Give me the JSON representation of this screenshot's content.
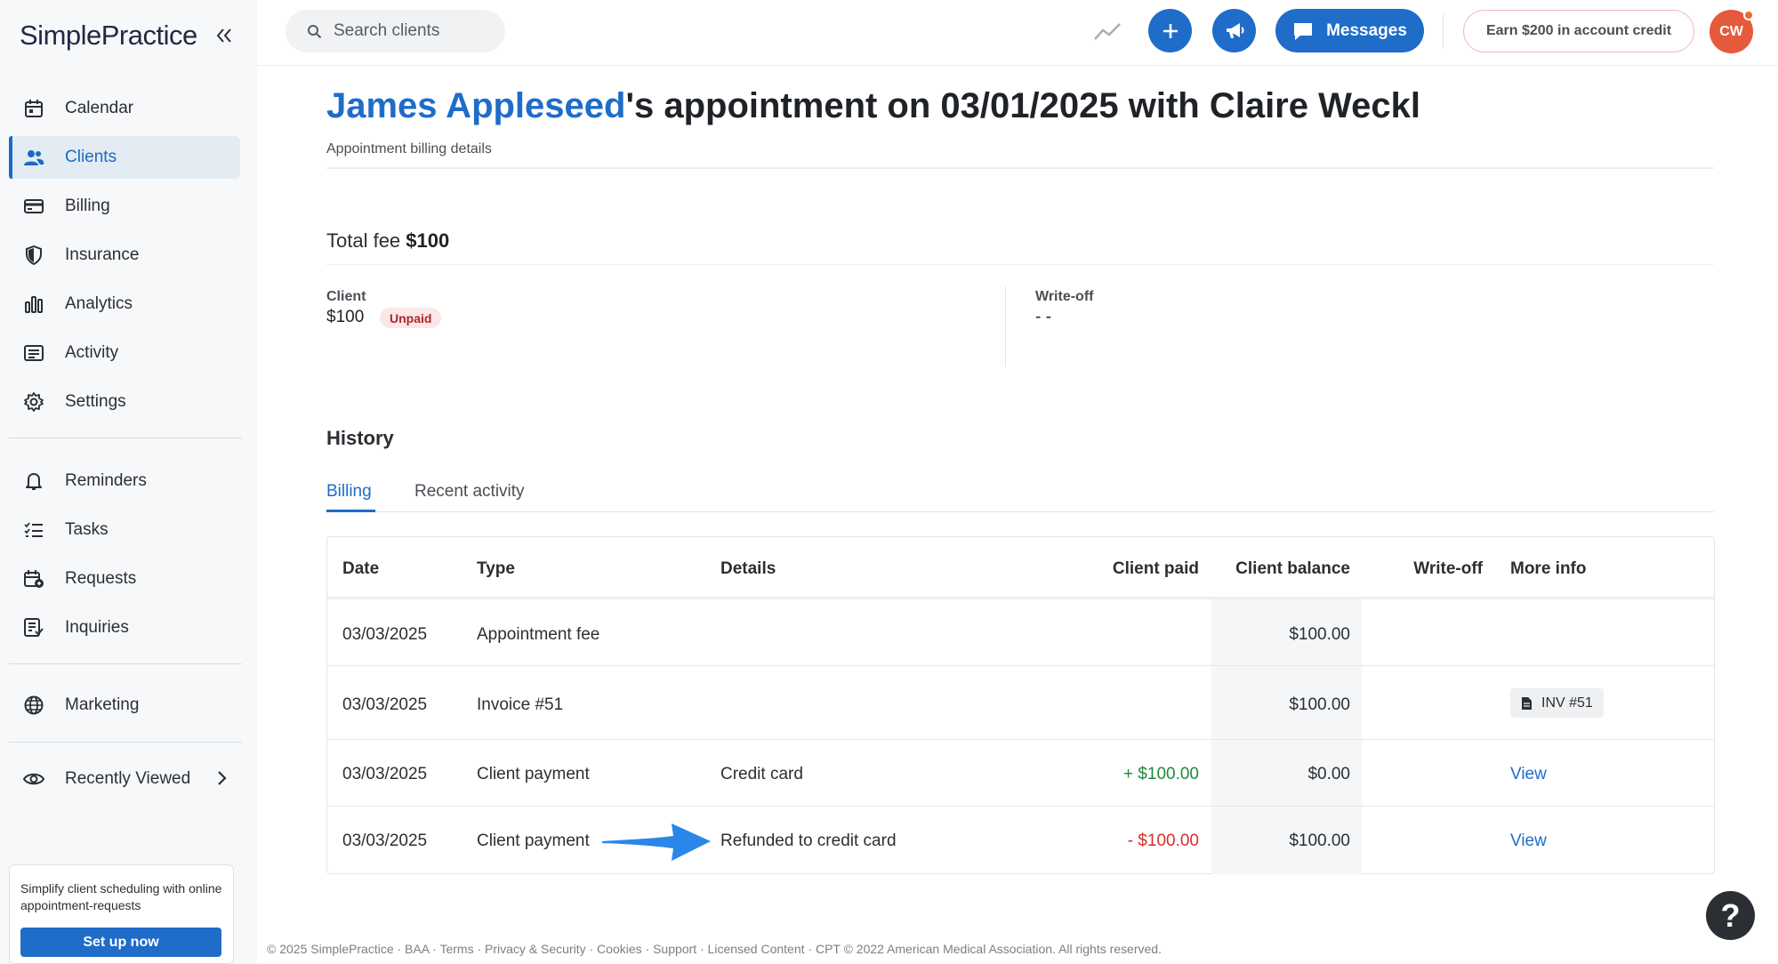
{
  "app": {
    "logo": "SimplePractice"
  },
  "sidebar": {
    "items": [
      {
        "label": "Calendar",
        "icon": "calendar-icon"
      },
      {
        "label": "Clients",
        "icon": "clients-icon",
        "active": true
      },
      {
        "label": "Billing",
        "icon": "billing-icon"
      },
      {
        "label": "Insurance",
        "icon": "shield-icon"
      },
      {
        "label": "Analytics",
        "icon": "analytics-icon"
      },
      {
        "label": "Activity",
        "icon": "activity-icon"
      },
      {
        "label": "Settings",
        "icon": "gear-icon"
      },
      {
        "label": "Reminders",
        "icon": "bell-icon"
      },
      {
        "label": "Tasks",
        "icon": "tasks-icon"
      },
      {
        "label": "Requests",
        "icon": "requests-icon"
      },
      {
        "label": "Inquiries",
        "icon": "inquiries-icon"
      },
      {
        "label": "Marketing",
        "icon": "globe-icon"
      },
      {
        "label": "Recently Viewed",
        "icon": "eye-icon"
      }
    ],
    "promo": {
      "text": "Simplify client scheduling with online appointment-requests",
      "button": "Set up now"
    }
  },
  "topbar": {
    "search_placeholder": "Search clients",
    "messages_label": "Messages",
    "earn_label": "Earn $200 in account credit",
    "avatar_initials": "CW"
  },
  "page": {
    "title_client": "James Appleseed",
    "title_rest": "'s appointment on 03/01/2025 with Claire Weckl",
    "subtitle": "Appointment billing details",
    "total_label": "Total fee",
    "total_value": "$100",
    "client_label": "Client",
    "client_value": "$100",
    "client_status": "Unpaid",
    "writeoff_label": "Write-off",
    "writeoff_value": "- -",
    "history_title": "History",
    "tabs": [
      "Billing",
      "Recent activity"
    ]
  },
  "table": {
    "headers": [
      "Date",
      "Type",
      "Details",
      "Client paid",
      "Client balance",
      "Write-off",
      "More info"
    ],
    "rows": [
      {
        "date": "03/03/2025",
        "type": "Appointment fee",
        "details": "",
        "paid": "",
        "balance": "$100.00",
        "writeoff": "",
        "more": ""
      },
      {
        "date": "03/03/2025",
        "type": "Invoice #51",
        "details": "",
        "paid": "",
        "balance": "$100.00",
        "writeoff": "",
        "more": "INV #51"
      },
      {
        "date": "03/03/2025",
        "type": "Client payment",
        "details": "Credit card",
        "paid": "+ $100.00",
        "balance": "$0.00",
        "writeoff": "",
        "more": "View"
      },
      {
        "date": "03/03/2025",
        "type": "Client payment",
        "details": "Refunded to credit card",
        "paid": "- $100.00",
        "balance": "$100.00",
        "writeoff": "",
        "more": "View"
      }
    ]
  },
  "footer": "© 2025 SimplePractice · BAA · Terms · Privacy & Security · Cookies · Support · Licensed Content · CPT © 2022 American Medical Association. All rights reserved.",
  "help_label": "?",
  "colors": {
    "accent": "#1f6cc9",
    "positive": "#1e8a3a",
    "negative": "#d62d2d",
    "badge_bg": "#fbe7e7",
    "avatar": "#e55a3c"
  }
}
